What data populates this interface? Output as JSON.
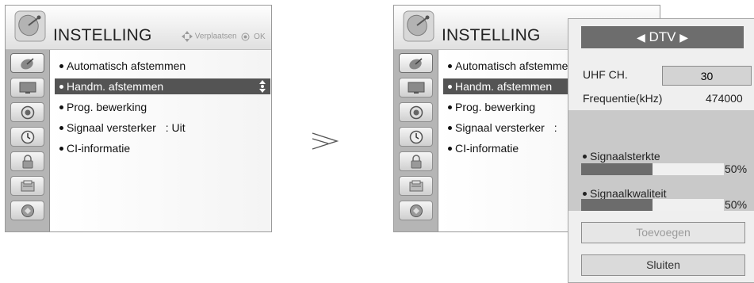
{
  "left_menu": {
    "title": "INSTELLING",
    "hint_move": "Verplaatsen",
    "hint_ok": "OK",
    "items": [
      {
        "label": "Automatisch afstemmen"
      },
      {
        "label": "Handm. afstemmen"
      },
      {
        "label": "Prog. bewerking"
      },
      {
        "label": "Signaal versterker"
      },
      {
        "label": "CI-informatie"
      }
    ],
    "signal_booster_value": ": Uit"
  },
  "right_menu": {
    "title": "INSTELLING",
    "items": [
      {
        "label": "Automatisch afstemme"
      },
      {
        "label": "Handm. afstemmen"
      },
      {
        "label": "Prog. bewerking"
      },
      {
        "label": "Signaal versterker"
      },
      {
        "label": "CI-informatie"
      }
    ],
    "signal_booster_value": ":"
  },
  "categories": [
    "satellite-icon",
    "tv-screen-icon",
    "speaker-icon",
    "clock-icon",
    "lock-icon",
    "option-icon",
    "usb-icon"
  ],
  "arrow_symbol": "⋗",
  "dialog": {
    "mode_label": "DTV",
    "uhf_label": "UHF CH.",
    "uhf_value": "30",
    "freq_label": "Frequentie(kHz)",
    "freq_value": "474000",
    "strength_label": "Signaalsterkte",
    "strength_value": "50%",
    "strength_fraction": 0.5,
    "quality_label": "Signaalkwaliteit",
    "quality_value": "50%",
    "quality_fraction": 0.5,
    "add_button": "Toevoegen",
    "close_button": "Sluiten"
  },
  "colors": {
    "selection": "#545454",
    "sidebar": "#b5b5b5",
    "dtv_header": "#6d6d6d"
  }
}
